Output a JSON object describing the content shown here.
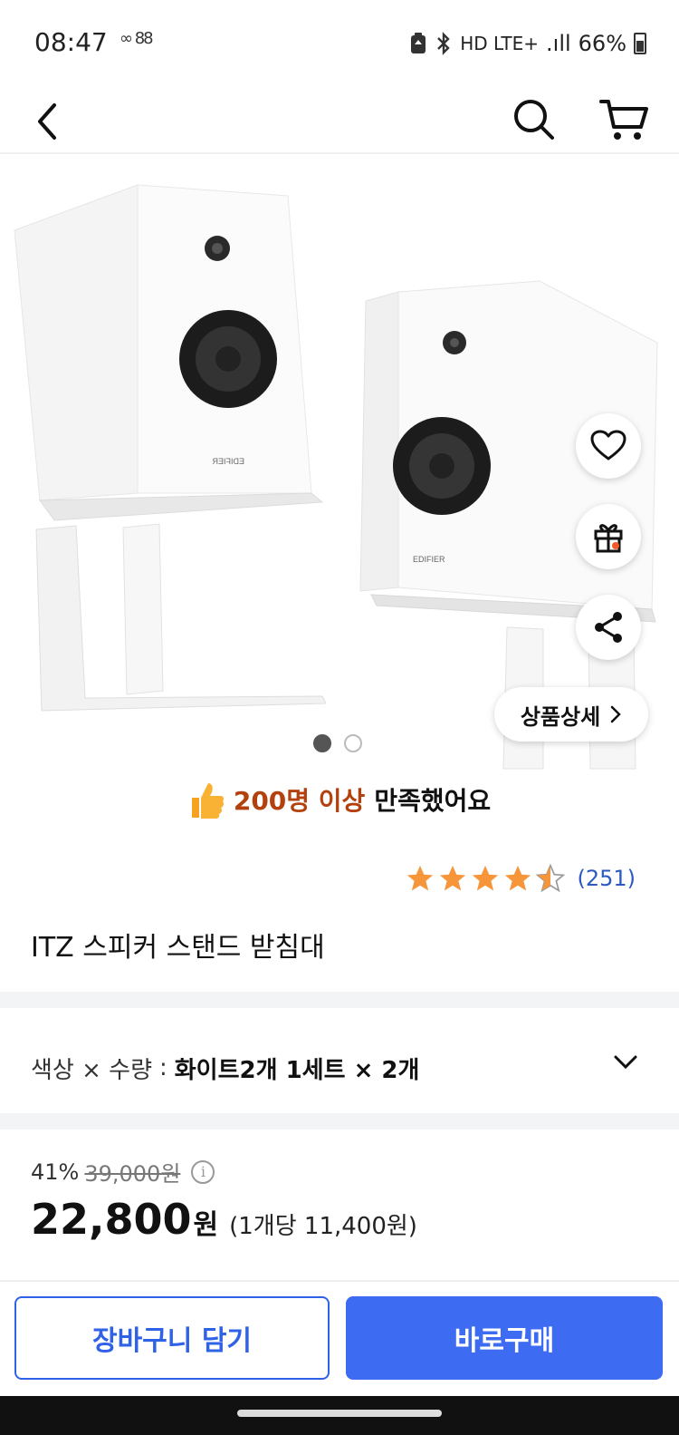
{
  "status_bar": {
    "time": "08:47",
    "extra": "∞ 88",
    "network": "HD LTE+",
    "signal": ".ıll",
    "battery": "66%"
  },
  "header": {
    "back_icon": "chevron-left-icon",
    "search_icon": "search-icon",
    "cart_icon": "cart-icon"
  },
  "hero": {
    "brand_text": "EDIFIER",
    "detail_button": "상품상세",
    "page_count": 2,
    "active_page": 1,
    "actions": [
      "heart-icon",
      "gift-icon",
      "share-icon"
    ]
  },
  "satisfaction": {
    "count": "200명 이상",
    "text": "만족했어요",
    "icon": "thumbs-up-icon"
  },
  "rating": {
    "stars": 4.5,
    "review_count": "(251)"
  },
  "product": {
    "title": "ITZ 스피커 스탠드 받침대"
  },
  "option": {
    "label": "색상 × 수량",
    "colon": ":",
    "value": "화이트2개 1세트 × 2개"
  },
  "price": {
    "discount_rate": "41%",
    "original_price": "39,000원",
    "sale_price": "22,800",
    "sale_unit": "원",
    "unit_price": "(1개당 11,400원)"
  },
  "buttons": {
    "cart": "장바구니 담기",
    "buy": "바로구매"
  },
  "colors": {
    "accent": "#3d6cf2",
    "rating_star": "#f7953a",
    "satisfaction_highlight": "#b3410e",
    "review_link": "#2b59c3"
  }
}
